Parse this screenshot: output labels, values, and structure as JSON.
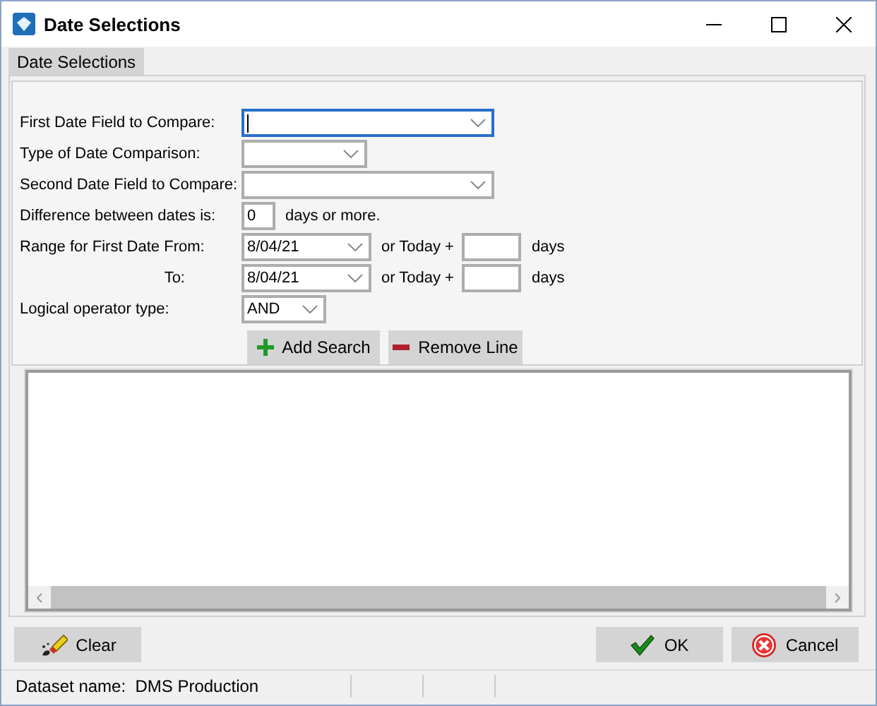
{
  "window": {
    "title": "Date Selections"
  },
  "tabs": [
    {
      "label": "Date Selections",
      "selected": true
    }
  ],
  "form": {
    "rows": [
      {
        "kind": "wide_combo",
        "label": "First Date Field to Compare:",
        "focused": true
      },
      {
        "kind": "narrow_combo",
        "label": "Type of Date Comparison:",
        "focused": false
      },
      {
        "kind": "wide_combo",
        "label": "Second Date Field to Compare:",
        "focused": false
      },
      {
        "kind": "number",
        "label": "Difference between dates is:",
        "value": "0",
        "suffix": "days or more."
      },
      {
        "kind": "date",
        "label": "Range for First Date From:",
        "value": "8/04/21",
        "offset_label": "or Today +",
        "unit": "days"
      },
      {
        "kind": "date_to",
        "label": "To:",
        "value": "8/04/21",
        "offset_label": "or Today +",
        "unit": "days"
      },
      {
        "kind": "small_combo",
        "label": "Logical operator type:",
        "value": "AND",
        "focused": false
      }
    ],
    "buttons": [
      {
        "label": "Add Search",
        "kind": "add"
      },
      {
        "label": "Remove Line",
        "kind": "remove"
      }
    ]
  },
  "footer_buttons": [
    {
      "label": "Clear",
      "kind": "clear"
    },
    {
      "label": "OK",
      "kind": "ok"
    },
    {
      "label": "Cancel",
      "kind": "cancel"
    }
  ],
  "status_bar": {
    "label": "Dataset name:",
    "value": "DMS Production"
  }
}
